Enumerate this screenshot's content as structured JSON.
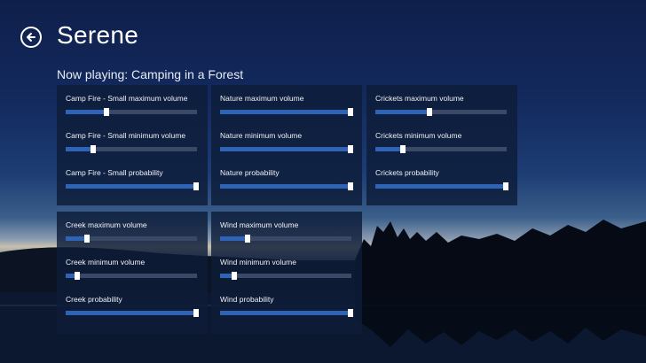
{
  "app": {
    "title": "Serene",
    "now_playing": "Now playing: Camping in a Forest"
  },
  "panels": [
    {
      "sliders": [
        {
          "label": "Camp Fire - Small maximum volume",
          "value": 0.31
        },
        {
          "label": "Camp Fire - Small minimum volume",
          "value": 0.21
        },
        {
          "label": "Camp Fire - Small probability",
          "value": 0.99
        }
      ]
    },
    {
      "sliders": [
        {
          "label": "Nature maximum volume",
          "value": 0.99
        },
        {
          "label": "Nature minimum volume",
          "value": 0.99
        },
        {
          "label": "Nature probability",
          "value": 0.99
        }
      ]
    },
    {
      "sliders": [
        {
          "label": "Crickets maximum volume",
          "value": 0.41
        },
        {
          "label": "Crickets minimum volume",
          "value": 0.21
        },
        {
          "label": "Crickets probability",
          "value": 0.99
        }
      ]
    },
    {
      "sliders": [
        {
          "label": "Creek maximum volume",
          "value": 0.16
        },
        {
          "label": "Creek minimum volume",
          "value": 0.09
        },
        {
          "label": "Creek probability",
          "value": 0.99
        }
      ]
    },
    {
      "sliders": [
        {
          "label": "Wind maximum volume",
          "value": 0.21
        },
        {
          "label": "Wind minimum volume",
          "value": 0.11
        },
        {
          "label": "Wind probability",
          "value": 0.99
        }
      ]
    }
  ],
  "colors": {
    "accent": "#2f63b5",
    "track": "#3a4a66",
    "panel": "#0e1c38"
  },
  "icons": {
    "back": "back-arrow-icon"
  }
}
